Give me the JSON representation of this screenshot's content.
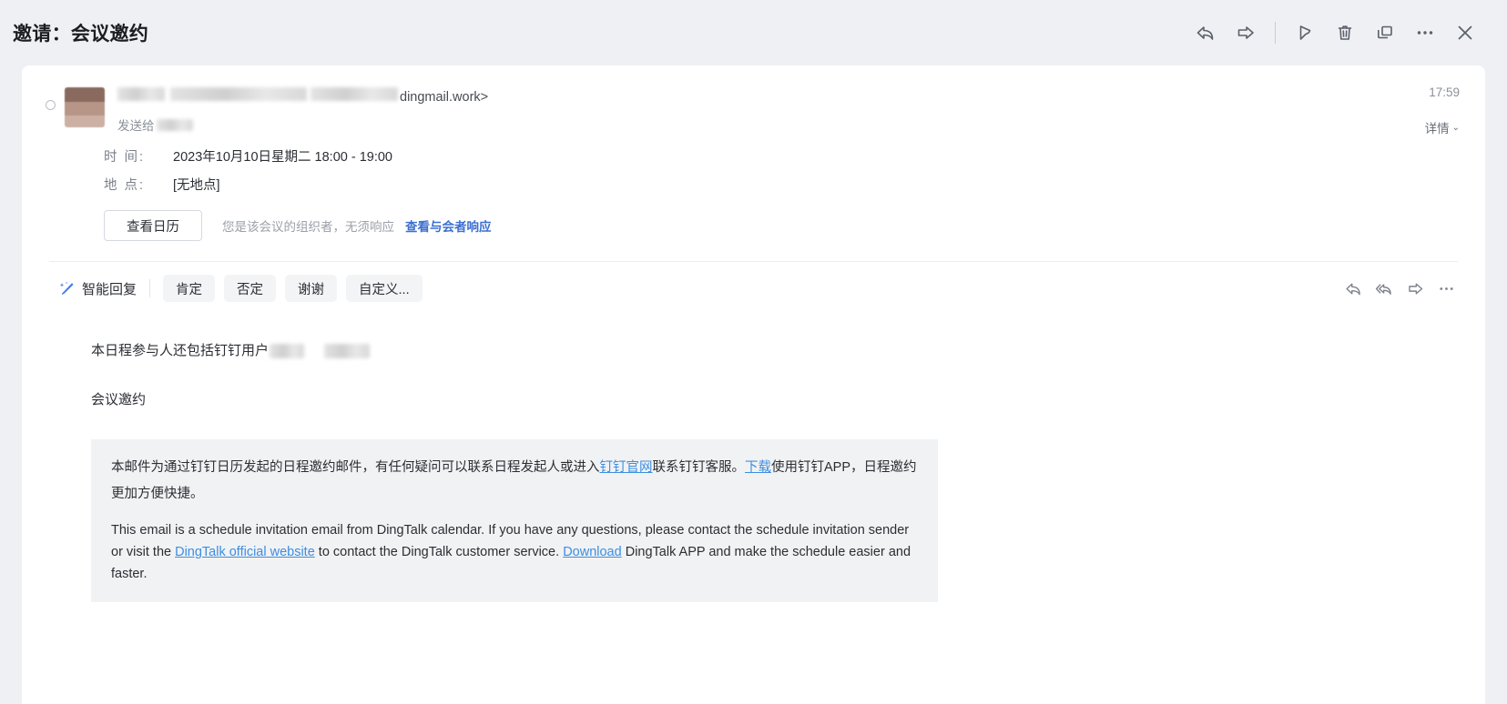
{
  "header": {
    "title": "邀请：会议邀约",
    "actions": [
      {
        "name": "reply-icon",
        "label": "回复"
      },
      {
        "name": "forward-icon",
        "label": "转发"
      },
      {
        "name": "flag-icon",
        "label": "标记"
      },
      {
        "name": "delete-icon",
        "label": "删除"
      },
      {
        "name": "windows-icon",
        "label": "新窗口打开"
      },
      {
        "name": "more-icon",
        "label": "更多"
      },
      {
        "name": "close-icon",
        "label": "关闭"
      }
    ]
  },
  "message": {
    "sender_domain": "dingmail.work>",
    "sent_to_label": "发送给",
    "timestamp": "17:59",
    "detail_label": "详情",
    "detail_chevron": "⌄"
  },
  "meeting": {
    "time_label": "时  间:",
    "time_value": "2023年10月10日星期二 18:00 - 19:00",
    "place_label": "地  点:",
    "place_value": "[无地点]",
    "calendar_button": "查看日历",
    "organizer_note": "您是该会议的组织者，无须响应",
    "attendee_link": "查看与会者响应"
  },
  "smart_reply": {
    "label": "智能回复",
    "chips": [
      "肯定",
      "否定",
      "谢谢",
      "自定义..."
    ],
    "icons": [
      {
        "name": "reply-icon",
        "label": "回复"
      },
      {
        "name": "reply-all-icon",
        "label": "全部回复"
      },
      {
        "name": "forward-icon",
        "label": "转发"
      },
      {
        "name": "more-icon",
        "label": "更多"
      }
    ]
  },
  "body": {
    "participants_prefix": "本日程参与人还包括钉钉用户",
    "subject_line": "会议邀约",
    "footer_cn_part1": "本邮件为通过钉钉日历发起的日程邀约邮件，有任何疑问可以联系日程发起人或进入",
    "footer_cn_link1": "钉钉官网",
    "footer_cn_part2": "联系钉钉客服。",
    "footer_cn_link2": "下载",
    "footer_cn_part3": "使用钉钉APP，日程邀约更加方便快捷。",
    "footer_en_part1": "This email is a schedule invitation email from DingTalk calendar. If you have any questions, please contact the schedule invitation sender or visit the ",
    "footer_en_link1": "DingTalk official website",
    "footer_en_part2": " to contact the DingTalk customer service. ",
    "footer_en_link2": "Download",
    "footer_en_part3": " DingTalk APP and make the schedule easier and faster."
  },
  "colors": {
    "link": "#3d8ee0",
    "accent_link": "#3d6fd1",
    "background": "#eef0f4",
    "card": "#ffffff",
    "footer_box": "#f1f2f4"
  }
}
